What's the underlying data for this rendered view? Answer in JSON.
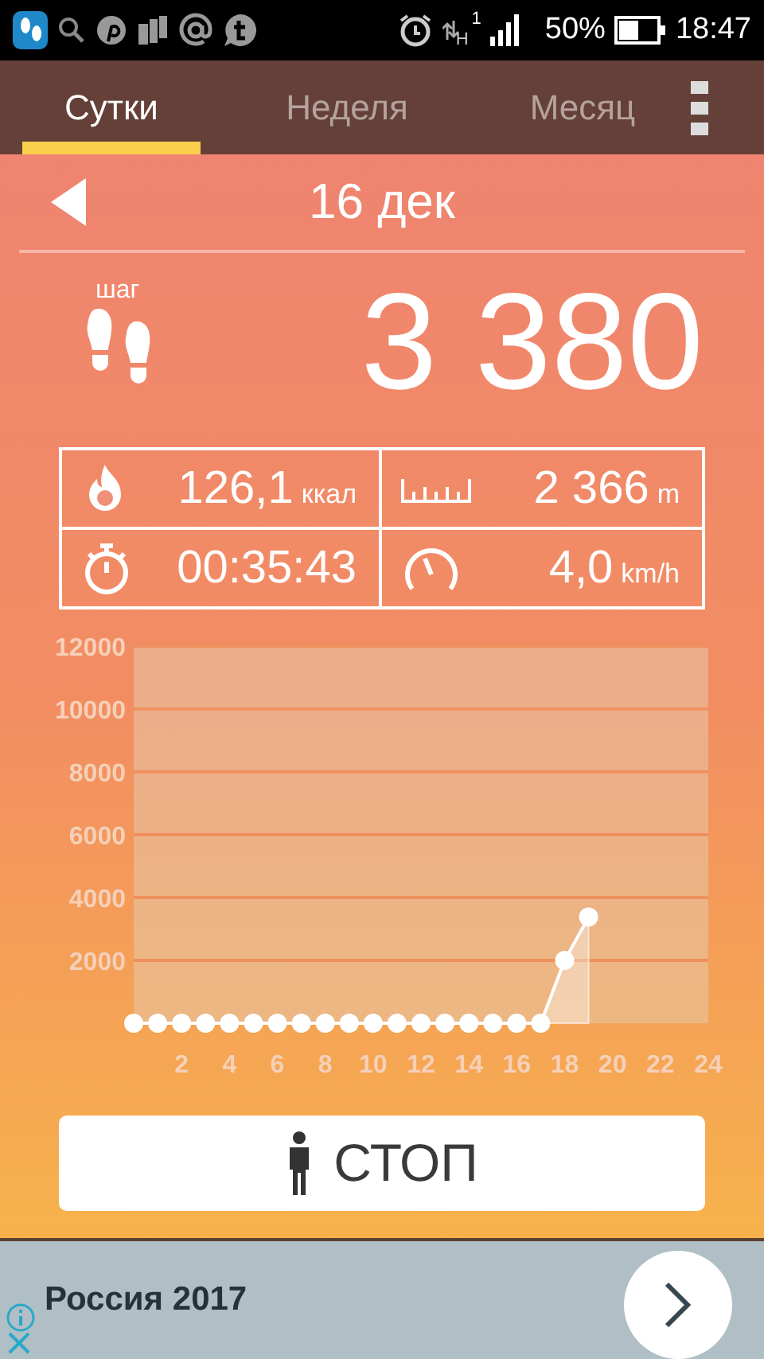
{
  "status_bar": {
    "network": "H",
    "sim": "1",
    "battery": "50%",
    "time": "18:47"
  },
  "tabs": [
    {
      "label": "Сутки",
      "selected": true
    },
    {
      "label": "Неделя",
      "selected": false
    },
    {
      "label": "Месяц",
      "selected": false
    }
  ],
  "date": "16 дек",
  "steps": {
    "label": "шаг",
    "value": "3 380"
  },
  "stats": [
    {
      "kind": "calories",
      "value": "126,1",
      "unit": "ккал"
    },
    {
      "kind": "distance",
      "value": "2 366",
      "unit": "m"
    },
    {
      "kind": "time",
      "value": "00:35:43"
    },
    {
      "kind": "speed",
      "value": "4,0",
      "unit": "km/h"
    }
  ],
  "chart": {
    "chart_data": {
      "type": "line",
      "grid": true,
      "marker": "circle",
      "x": [
        0,
        1,
        2,
        3,
        4,
        5,
        6,
        7,
        8,
        9,
        10,
        11,
        12,
        13,
        14,
        15,
        16,
        17,
        18,
        19
      ],
      "values": [
        0,
        0,
        0,
        0,
        0,
        0,
        0,
        0,
        0,
        0,
        0,
        0,
        0,
        0,
        0,
        0,
        0,
        0,
        2000,
        3380
      ],
      "xlim": [
        0,
        24
      ],
      "ylim": [
        0,
        12000
      ],
      "xticks": [
        2,
        4,
        6,
        8,
        10,
        12,
        14,
        16,
        18,
        20,
        22,
        24
      ],
      "yticks": [
        2000,
        4000,
        6000,
        8000,
        10000,
        12000
      ]
    }
  },
  "stop_button": "СТОП",
  "ad": {
    "title": "Россия 2017"
  }
}
